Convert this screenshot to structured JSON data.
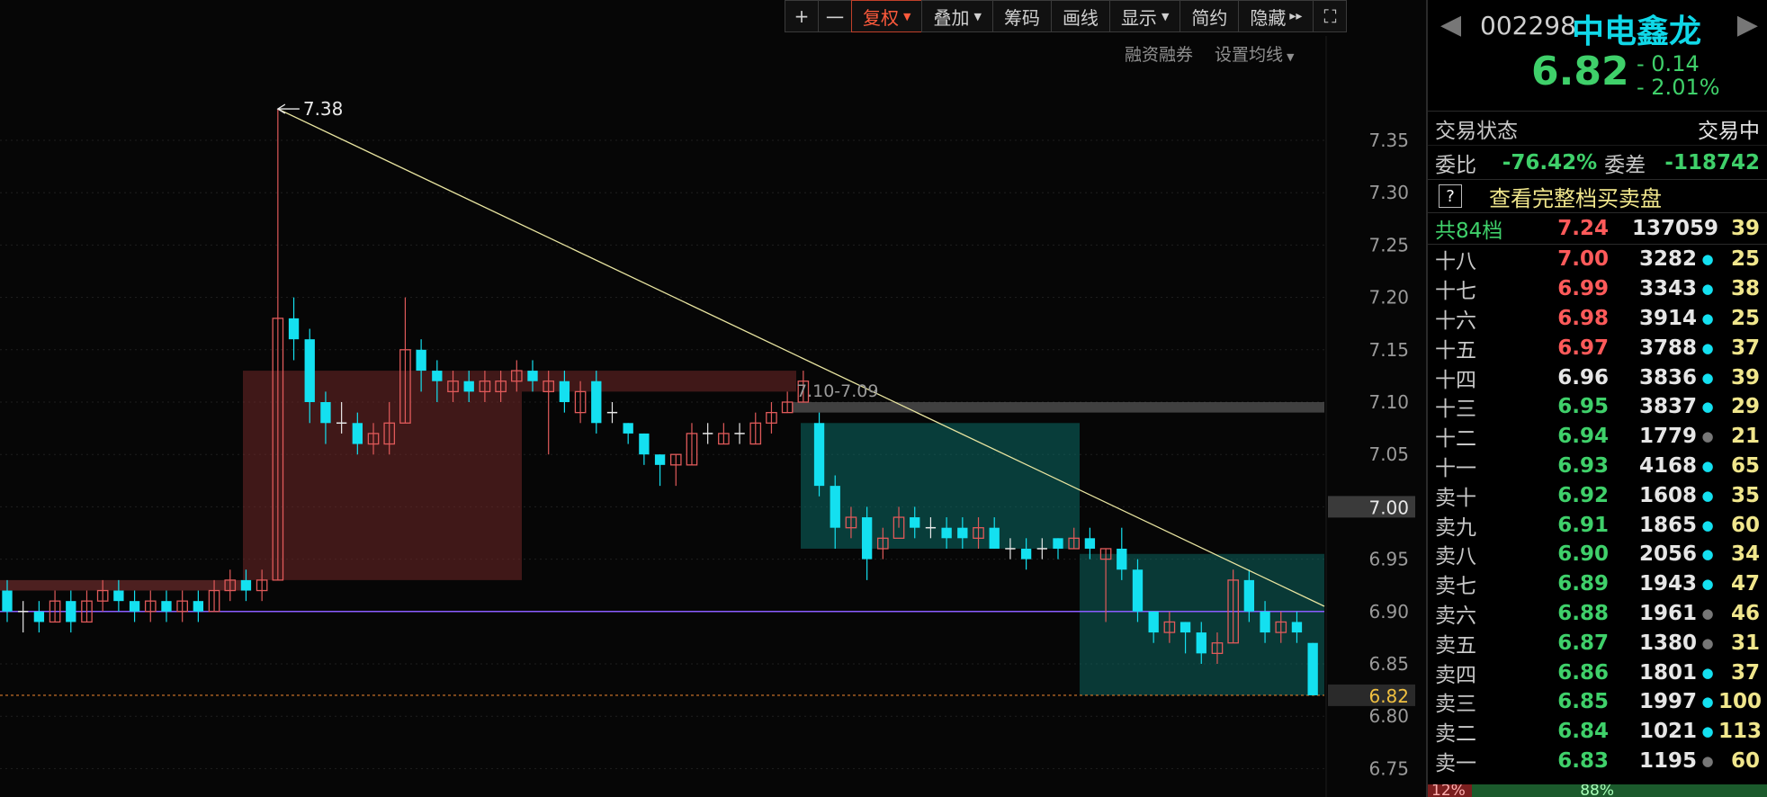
{
  "toolbar": {
    "plus": "+",
    "minus": "一",
    "fuquan": "复权",
    "diejia": "叠加",
    "chouma": "筹码",
    "huaxian": "画线",
    "xianshi": "显示",
    "jianyue": "简约",
    "yincang": "隐藏",
    "yincang_arrows": "▸▸",
    "fullscreen": "⛶"
  },
  "subbar": {
    "rongzi": "融资融券",
    "junxian": "设置均线"
  },
  "chart": {
    "y_ticks": [
      "7.35",
      "7.30",
      "7.25",
      "7.20",
      "7.15",
      "7.10",
      "7.05",
      "7.00",
      "6.95",
      "6.90",
      "6.85",
      "6.80",
      "6.75"
    ],
    "y_tick_values": [
      7.35,
      7.3,
      7.25,
      7.2,
      7.15,
      7.1,
      7.05,
      7.0,
      6.95,
      6.9,
      6.85,
      6.8,
      6.75
    ],
    "high_label": "7.38",
    "zone_label": "7.10-7.09",
    "cursor_price": "7.00",
    "current_price": "6.82",
    "colors": {
      "up": "#e05a5a",
      "down": "#14e0f0",
      "trend": "#e8e4a0",
      "base": "#8a5cff"
    }
  },
  "panel": {
    "code": "002298",
    "name": "中电鑫龙",
    "price": "6.82",
    "change": "- 0.14",
    "change_pct": "- 2.01%",
    "trade_status_label": "交易状态",
    "trade_status_value": "交易中",
    "weibi_label": "委比",
    "weibi_value": "-76.42%",
    "weicha_label": "委差",
    "weicha_value": "-118742",
    "view_full": "查看完整档买卖盘",
    "q_mark": "?",
    "total": {
      "label": "共84档",
      "price": "7.24",
      "vol": "137059",
      "count": "39"
    },
    "levels": [
      {
        "label": "十八",
        "price": "7.00",
        "vol": "3282",
        "dot": "cyan",
        "count": "25",
        "pc": "red"
      },
      {
        "label": "十七",
        "price": "6.99",
        "vol": "3343",
        "dot": "cyan",
        "count": "38",
        "pc": "red"
      },
      {
        "label": "十六",
        "price": "6.98",
        "vol": "3914",
        "dot": "cyan",
        "count": "25",
        "pc": "red"
      },
      {
        "label": "十五",
        "price": "6.97",
        "vol": "3788",
        "dot": "cyan",
        "count": "37",
        "pc": "red"
      },
      {
        "label": "十四",
        "price": "6.96",
        "vol": "3836",
        "dot": "cyan",
        "count": "39",
        "pc": "white"
      },
      {
        "label": "十三",
        "price": "6.95",
        "vol": "3837",
        "dot": "cyan",
        "count": "29",
        "pc": "green"
      },
      {
        "label": "十二",
        "price": "6.94",
        "vol": "1779",
        "dot": "gray",
        "count": "21",
        "pc": "green"
      },
      {
        "label": "十一",
        "price": "6.93",
        "vol": "4168",
        "dot": "cyan",
        "count": "65",
        "pc": "green"
      },
      {
        "label": "卖十",
        "price": "6.92",
        "vol": "1608",
        "dot": "cyan",
        "count": "35",
        "pc": "green"
      },
      {
        "label": "卖九",
        "price": "6.91",
        "vol": "1865",
        "dot": "cyan",
        "count": "60",
        "pc": "green"
      },
      {
        "label": "卖八",
        "price": "6.90",
        "vol": "2056",
        "dot": "cyan",
        "count": "34",
        "pc": "green"
      },
      {
        "label": "卖七",
        "price": "6.89",
        "vol": "1943",
        "dot": "cyan",
        "count": "47",
        "pc": "green"
      },
      {
        "label": "卖六",
        "price": "6.88",
        "vol": "1961",
        "dot": "gray",
        "count": "46",
        "pc": "green"
      },
      {
        "label": "卖五",
        "price": "6.87",
        "vol": "1380",
        "dot": "gray",
        "count": "31",
        "pc": "green"
      },
      {
        "label": "卖四",
        "price": "6.86",
        "vol": "1801",
        "dot": "cyan",
        "count": "37",
        "pc": "green"
      },
      {
        "label": "卖三",
        "price": "6.85",
        "vol": "1997",
        "dot": "cyan",
        "count": "100",
        "pc": "green"
      },
      {
        "label": "卖二",
        "price": "6.84",
        "vol": "1021",
        "dot": "cyan",
        "count": "113",
        "pc": "green"
      },
      {
        "label": "卖一",
        "price": "6.83",
        "vol": "1195",
        "dot": "gray",
        "count": "60",
        "pc": "green"
      }
    ],
    "ratio_left": "12%",
    "ratio_right": "88%"
  },
  "candles": [
    [
      6.92,
      6.9,
      6.93,
      6.89
    ],
    [
      6.9,
      6.9,
      6.91,
      6.88
    ],
    [
      6.9,
      6.89,
      6.91,
      6.88
    ],
    [
      6.89,
      6.91,
      6.92,
      6.89
    ],
    [
      6.91,
      6.89,
      6.92,
      6.88
    ],
    [
      6.89,
      6.91,
      6.92,
      6.89
    ],
    [
      6.91,
      6.92,
      6.93,
      6.9
    ],
    [
      6.92,
      6.91,
      6.93,
      6.9
    ],
    [
      6.91,
      6.9,
      6.92,
      6.89
    ],
    [
      6.9,
      6.91,
      6.92,
      6.89
    ],
    [
      6.91,
      6.9,
      6.92,
      6.89
    ],
    [
      6.9,
      6.91,
      6.92,
      6.89
    ],
    [
      6.91,
      6.9,
      6.92,
      6.89
    ],
    [
      6.9,
      6.92,
      6.93,
      6.9
    ],
    [
      6.92,
      6.93,
      6.94,
      6.91
    ],
    [
      6.93,
      6.92,
      6.94,
      6.91
    ],
    [
      6.92,
      6.93,
      6.94,
      6.91
    ],
    [
      6.93,
      7.18,
      7.38,
      6.93
    ],
    [
      7.18,
      7.16,
      7.2,
      7.14
    ],
    [
      7.16,
      7.1,
      7.17,
      7.08
    ],
    [
      7.1,
      7.08,
      7.11,
      7.06
    ],
    [
      7.08,
      7.08,
      7.1,
      7.07
    ],
    [
      7.08,
      7.06,
      7.09,
      7.05
    ],
    [
      7.06,
      7.07,
      7.08,
      7.05
    ],
    [
      7.06,
      7.08,
      7.1,
      7.05
    ],
    [
      7.08,
      7.15,
      7.2,
      7.08
    ],
    [
      7.15,
      7.13,
      7.16,
      7.11
    ],
    [
      7.13,
      7.12,
      7.14,
      7.1
    ],
    [
      7.11,
      7.12,
      7.13,
      7.1
    ],
    [
      7.12,
      7.11,
      7.13,
      7.1
    ],
    [
      7.11,
      7.12,
      7.13,
      7.1
    ],
    [
      7.11,
      7.12,
      7.13,
      7.1
    ],
    [
      7.12,
      7.13,
      7.14,
      7.11
    ],
    [
      7.13,
      7.12,
      7.14,
      7.11
    ],
    [
      7.11,
      7.12,
      7.13,
      7.05
    ],
    [
      7.12,
      7.1,
      7.13,
      7.09
    ],
    [
      7.09,
      7.11,
      7.12,
      7.08
    ],
    [
      7.12,
      7.08,
      7.13,
      7.07
    ],
    [
      7.09,
      7.09,
      7.1,
      7.08
    ],
    [
      7.08,
      7.07,
      7.08,
      7.06
    ],
    [
      7.07,
      7.05,
      7.07,
      7.04
    ],
    [
      7.05,
      7.04,
      7.05,
      7.02
    ],
    [
      7.04,
      7.05,
      7.05,
      7.02
    ],
    [
      7.04,
      7.07,
      7.08,
      7.04
    ],
    [
      7.07,
      7.07,
      7.08,
      7.06
    ],
    [
      7.06,
      7.07,
      7.08,
      7.06
    ],
    [
      7.07,
      7.07,
      7.08,
      7.06
    ],
    [
      7.06,
      7.08,
      7.09,
      7.06
    ],
    [
      7.08,
      7.09,
      7.1,
      7.07
    ],
    [
      7.09,
      7.1,
      7.11,
      7.09
    ],
    [
      7.1,
      7.12,
      7.13,
      7.1
    ],
    [
      7.08,
      7.02,
      7.09,
      7.01
    ],
    [
      7.02,
      6.98,
      7.03,
      6.96
    ],
    [
      6.98,
      6.99,
      7.0,
      6.97
    ],
    [
      6.99,
      6.95,
      7.0,
      6.93
    ],
    [
      6.96,
      6.97,
      6.98,
      6.95
    ],
    [
      6.97,
      6.99,
      7.0,
      6.98
    ],
    [
      6.99,
      6.98,
      7.0,
      6.97
    ],
    [
      6.98,
      6.98,
      6.99,
      6.97
    ],
    [
      6.98,
      6.97,
      6.99,
      6.96
    ],
    [
      6.98,
      6.97,
      6.99,
      6.96
    ],
    [
      6.97,
      6.98,
      6.99,
      6.96
    ],
    [
      6.98,
      6.96,
      6.99,
      6.96
    ],
    [
      6.96,
      6.96,
      6.97,
      6.95
    ],
    [
      6.96,
      6.95,
      6.97,
      6.94
    ],
    [
      6.96,
      6.96,
      6.97,
      6.95
    ],
    [
      6.97,
      6.96,
      6.97,
      6.95
    ],
    [
      6.96,
      6.97,
      6.98,
      6.96
    ],
    [
      6.97,
      6.96,
      6.98,
      6.95
    ],
    [
      6.95,
      6.96,
      6.96,
      6.89
    ],
    [
      6.96,
      6.94,
      6.98,
      6.93
    ],
    [
      6.94,
      6.9,
      6.95,
      6.89
    ],
    [
      6.9,
      6.88,
      6.9,
      6.87
    ],
    [
      6.88,
      6.89,
      6.9,
      6.87
    ],
    [
      6.89,
      6.88,
      6.89,
      6.86
    ],
    [
      6.88,
      6.86,
      6.89,
      6.85
    ],
    [
      6.86,
      6.87,
      6.88,
      6.85
    ],
    [
      6.87,
      6.93,
      6.94,
      6.87
    ],
    [
      6.93,
      6.9,
      6.94,
      6.89
    ],
    [
      6.9,
      6.88,
      6.91,
      6.87
    ],
    [
      6.88,
      6.89,
      6.9,
      6.87
    ],
    [
      6.89,
      6.88,
      6.9,
      6.87
    ],
    [
      6.87,
      6.82,
      6.87,
      6.82
    ]
  ]
}
